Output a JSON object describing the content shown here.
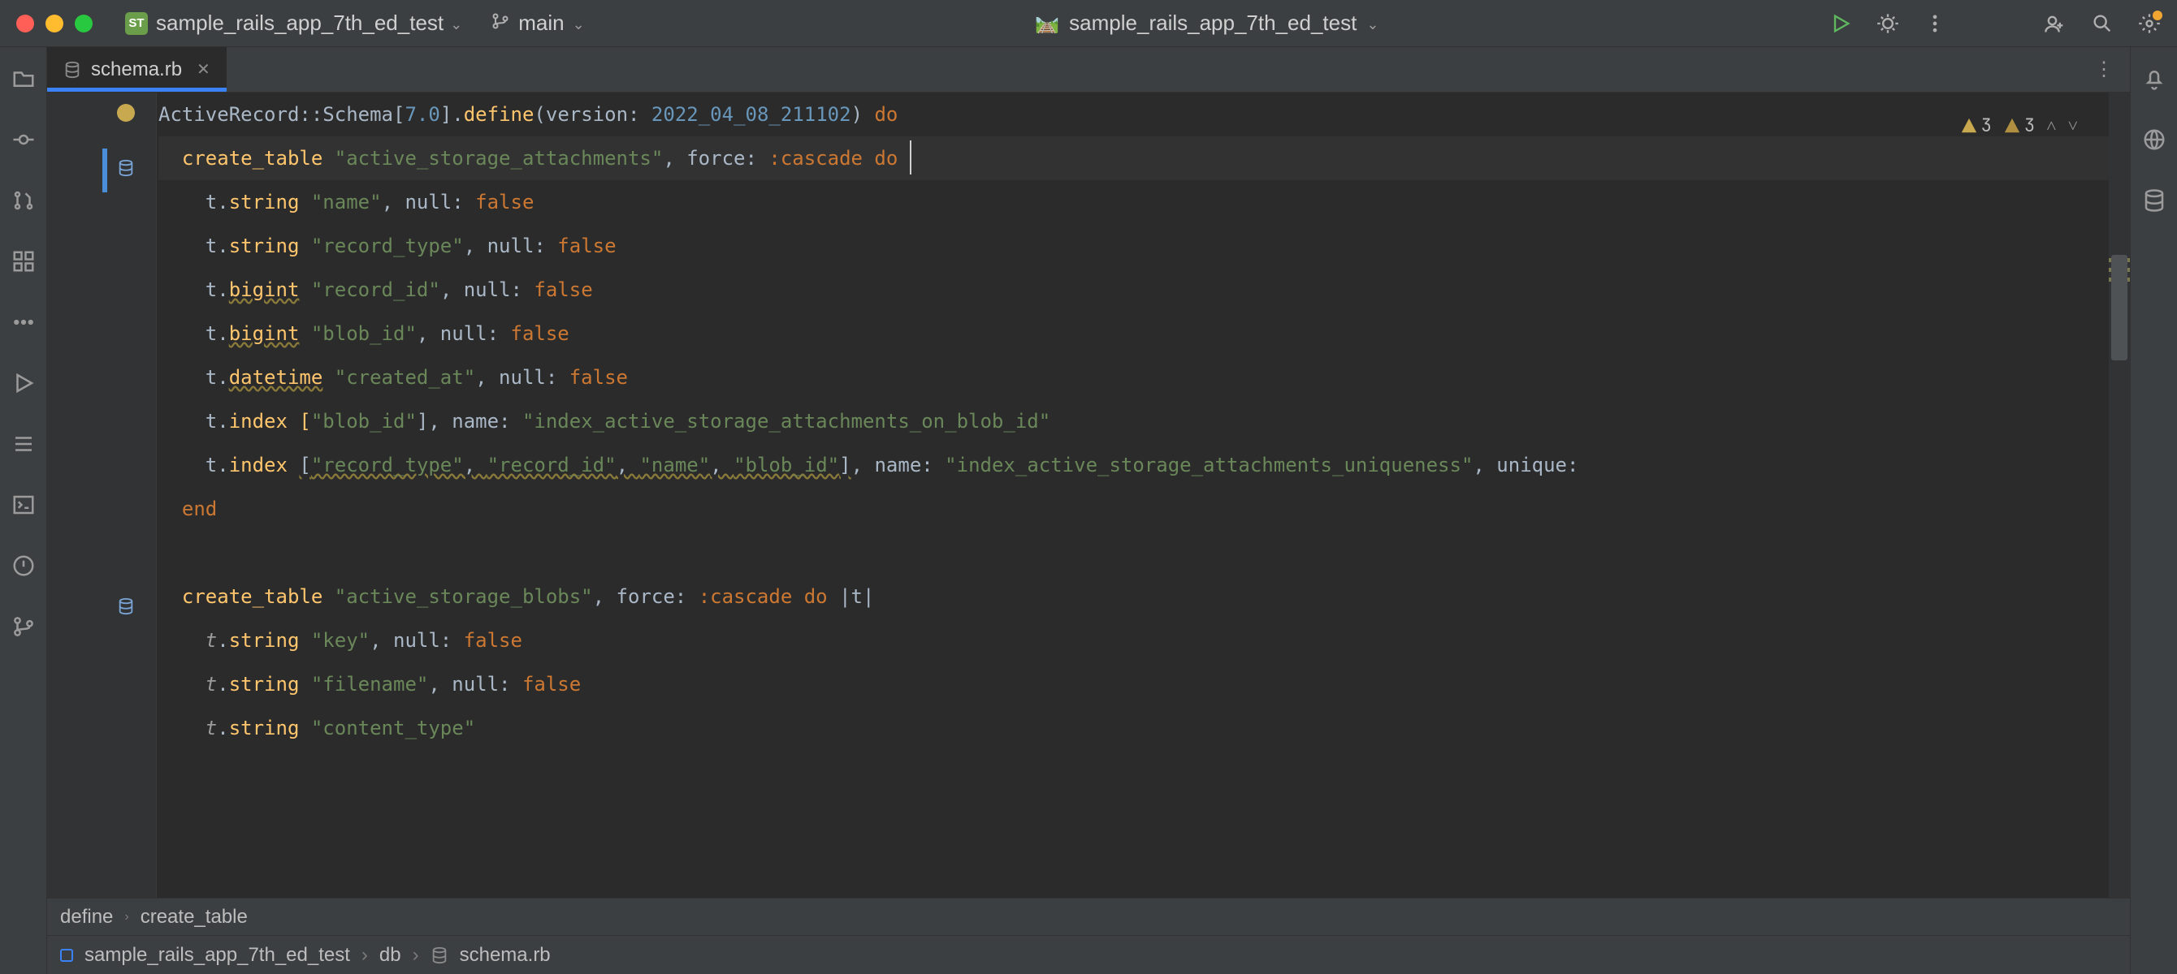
{
  "titlebar": {
    "project_badge": "ST",
    "project_name": "sample_rails_app_7th_ed_test",
    "branch": "main",
    "run_config": "sample_rails_app_7th_ed_test"
  },
  "tab": {
    "label": "schema.rb"
  },
  "inspections": {
    "warnings_a": "3",
    "warnings_b": "3"
  },
  "code": {
    "l1a": "ActiveRecord",
    "l1b": "::",
    "l1c": "Schema",
    "l1d": "[",
    "l1e": "7.0",
    "l1f": "].",
    "l1g": "define",
    "l1h": "(version: ",
    "l1i": "2022_04_08_211102",
    "l1j": ") ",
    "l1k": "do",
    "l2a": "  ",
    "l2b": "create_table ",
    "l2c": "\"active_storage_attachments\"",
    "l2d": ", force: ",
    "l2e": ":cascade",
    "l2f": " ",
    "l2g": "do ",
    "l3a": "    t.",
    "l3b": "string ",
    "l3c": "\"name\"",
    "l3d": ", null: ",
    "l3e": "false",
    "l4a": "    t.",
    "l4b": "string ",
    "l4c": "\"record_type\"",
    "l4d": ", null: ",
    "l4e": "false",
    "l5a": "    t.",
    "l5b": "bigint",
    "l5c": " ",
    "l5d": "\"record_id\"",
    "l5e": ", null: ",
    "l5f": "false",
    "l6a": "    t.",
    "l6b": "bigint",
    "l6c": " ",
    "l6d": "\"blob_id\"",
    "l6e": ", null: ",
    "l6f": "false",
    "l7a": "    t.",
    "l7b": "datetime",
    "l7c": " ",
    "l7d": "\"created_at\"",
    "l7e": ", null: ",
    "l7f": "false",
    "l8a": "    t.",
    "l8b": "index [",
    "l8c": "\"blob_id\"",
    "l8d": "], name: ",
    "l8e": "\"index_active_storage_attachments_on_blob_id\"",
    "l9a": "    t.",
    "l9b": "index ",
    "l9c": "[",
    "l9d": "\"record_type\"",
    "l9e": ", ",
    "l9f": "\"record_id\"",
    "l9g": ", ",
    "l9h": "\"name\"",
    "l9i": ", ",
    "l9j": "\"blob_id\"",
    "l9k": "]",
    "l9l": ", name: ",
    "l9m": "\"index_active_storage_attachments_uniqueness\"",
    "l9n": ", unique:",
    "l10": "  end",
    "l12a": "  ",
    "l12b": "create_table ",
    "l12c": "\"active_storage_blobs\"",
    "l12d": ", force: ",
    "l12e": ":cascade",
    "l12f": " ",
    "l12g": "do",
    "l12h": " |",
    "l12i": "t",
    "l12j": "|",
    "l13a": "    ",
    "l13b": "t",
    "l13c": ".",
    "l13d": "string ",
    "l13e": "\"key\"",
    "l13f": ", null: ",
    "l13g": "false",
    "l14a": "    ",
    "l14b": "t",
    "l14c": ".",
    "l14d": "string ",
    "l14e": "\"filename\"",
    "l14f": ", null: ",
    "l14g": "false",
    "l15a": "    ",
    "l15b": "t",
    "l15c": ".",
    "l15d": "string ",
    "l15e": "\"content_type\""
  },
  "breadcrumb_top": {
    "a": "define",
    "b": "create_table"
  },
  "breadcrumb_bot": {
    "a": "sample_rails_app_7th_ed_test",
    "b": "db",
    "c": "schema.rb"
  }
}
